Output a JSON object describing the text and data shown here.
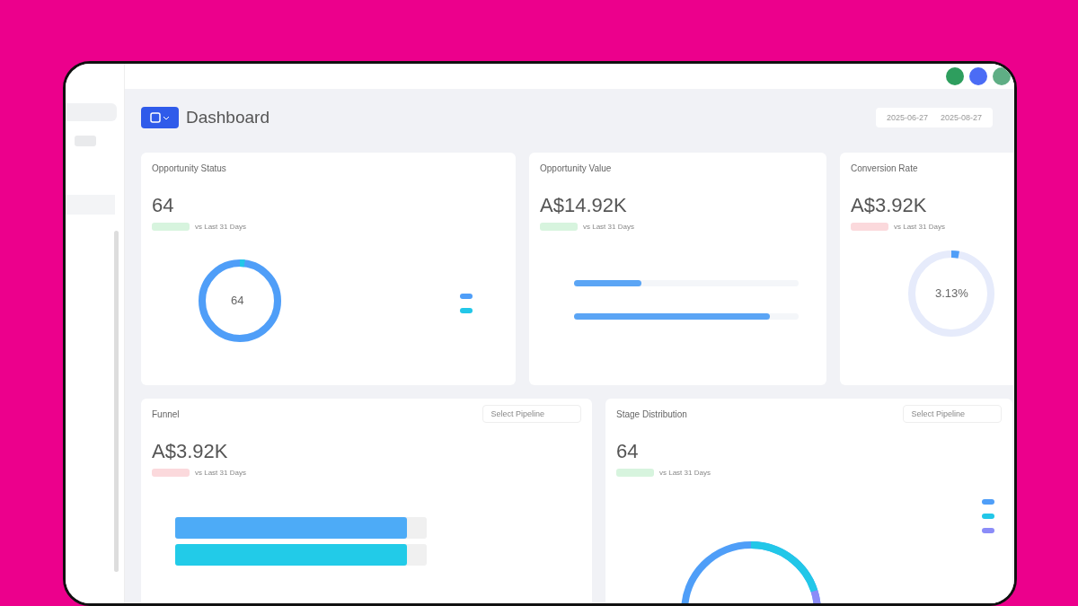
{
  "header": {
    "title": "Dashboard",
    "date_start": "2025-06-27",
    "date_end": "2025-08-27"
  },
  "cards": [
    {
      "kind": "donut",
      "title": "Opportunity Status",
      "value": "64",
      "badge": {
        "color": "#d7f4de"
      },
      "comparison": "vs Last 31 Days",
      "center": "64",
      "legend": [
        {
          "color": "#4f9ef8"
        },
        {
          "color": "#22c7e8"
        }
      ]
    },
    {
      "kind": "bars",
      "title": "Opportunity Value",
      "value": "A$14.92K",
      "badge": {
        "color": "#d7f4de"
      },
      "comparison": "vs Last 31 Days",
      "bars": [
        {
          "level": 0.3
        },
        {
          "level": 0.87
        }
      ]
    },
    {
      "kind": "ring",
      "title": "Conversion Rate",
      "value": "A$3.92K",
      "badge": {
        "color": "#fbd9dc"
      },
      "comparison": "vs Last 31 Days",
      "center": "3.13%",
      "level": 0.03
    },
    {
      "kind": "funnel",
      "title": "Funnel",
      "value": "A$3.92K",
      "badge": {
        "color": "#fbd9dc"
      },
      "comparison": "vs Last 31 Days",
      "dropdown": "Select Pipeline",
      "bars": [
        {
          "color": "#4dabf7",
          "level": 0.92
        },
        {
          "color": "#22cbe8",
          "level": 0.92
        }
      ]
    },
    {
      "kind": "stage",
      "title": "Stage Distribution",
      "value": "64",
      "badge": {
        "color": "#d7f4de"
      },
      "comparison": "vs Last 31 Days",
      "dropdown": "Select Pipeline",
      "legend": [
        {
          "color": "#4f9ef8"
        },
        {
          "color": "#22c7e8"
        },
        {
          "color": "#8b8cf8"
        }
      ]
    }
  ]
}
